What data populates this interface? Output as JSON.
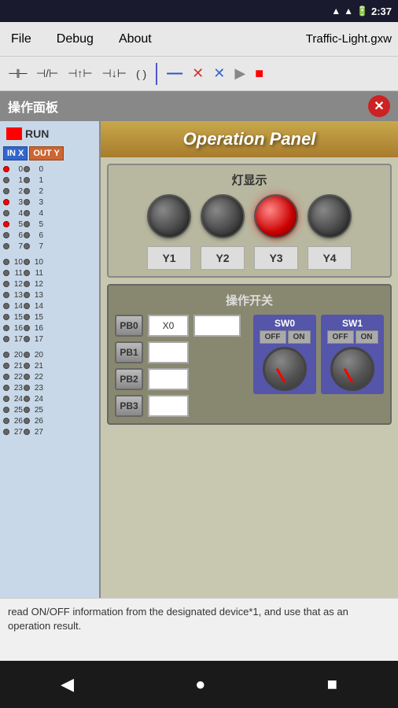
{
  "statusBar": {
    "time": "2:37",
    "icons": [
      "wifi",
      "signal",
      "battery"
    ]
  },
  "menuBar": {
    "items": [
      "File",
      "Debug",
      "About"
    ],
    "title": "Traffic-Light.gxw"
  },
  "toolbar": {
    "buttons": [
      {
        "name": "contact-normally-open",
        "symbol": "⊣⊢"
      },
      {
        "name": "contact-normally-closed",
        "symbol": "⊣/⊢"
      },
      {
        "name": "contact-positive",
        "symbol": "⊣↑⊢"
      },
      {
        "name": "contact-negative",
        "symbol": "⊣↓⊢"
      },
      {
        "name": "coil",
        "symbol": "( )"
      },
      {
        "name": "divider"
      },
      {
        "name": "line",
        "symbol": "—"
      },
      {
        "name": "cross-red",
        "symbol": "✕"
      },
      {
        "name": "cross-blue",
        "symbol": "✕"
      },
      {
        "name": "play",
        "symbol": "▶"
      },
      {
        "name": "stop",
        "symbol": "■"
      }
    ]
  },
  "panelWindow": {
    "title": "操作面板",
    "closeBtn": "✕",
    "runLabel": "RUN",
    "opHeader": "Operation Panel",
    "lightSection": {
      "title": "灯显示",
      "lights": [
        {
          "id": "L1",
          "on": false,
          "label": "Y1"
        },
        {
          "id": "L2",
          "on": false,
          "label": "Y2"
        },
        {
          "id": "L3",
          "on": true,
          "label": "Y3"
        },
        {
          "id": "L4",
          "on": false,
          "label": "Y4"
        }
      ]
    },
    "switchSection": {
      "title": "操作开关",
      "pushButtons": [
        "PB0",
        "PB1",
        "PB2",
        "PB3"
      ],
      "inputs": [
        "X0",
        "",
        "",
        ""
      ],
      "switches": [
        {
          "label": "SW0",
          "offLabel": "OFF",
          "onLabel": "ON"
        },
        {
          "label": "SW1",
          "offLabel": "OFF",
          "onLabel": "ON"
        }
      ]
    },
    "ioSidebar": {
      "inHeader": "IN X",
      "outHeader": "OUT Y",
      "rows": [
        {
          "num": 0,
          "inDot": true,
          "outDot": false
        },
        {
          "num": 1,
          "inDot": false,
          "outDot": false
        },
        {
          "num": 2,
          "inDot": false,
          "outDot": false
        },
        {
          "num": 3,
          "inDot": true,
          "outDot": false
        },
        {
          "num": 4,
          "inDot": false,
          "outDot": false
        },
        {
          "num": 5,
          "inDot": true,
          "outDot": false
        },
        {
          "num": 6,
          "inDot": false,
          "outDot": false
        },
        {
          "num": 7,
          "inDot": false,
          "outDot": false
        },
        {
          "num": 10,
          "inDot": false,
          "outDot": false
        },
        {
          "num": 11,
          "inDot": false,
          "outDot": false
        },
        {
          "num": 12,
          "inDot": false,
          "outDot": false
        },
        {
          "num": 13,
          "inDot": false,
          "outDot": false
        },
        {
          "num": 14,
          "inDot": false,
          "outDot": false
        },
        {
          "num": 15,
          "inDot": false,
          "outDot": false
        },
        {
          "num": 16,
          "inDot": false,
          "outDot": false
        },
        {
          "num": 17,
          "inDot": false,
          "outDot": false
        },
        {
          "num": 20,
          "inDot": false,
          "outDot": false
        },
        {
          "num": 21,
          "inDot": false,
          "outDot": false
        },
        {
          "num": 22,
          "inDot": false,
          "outDot": false
        },
        {
          "num": 23,
          "inDot": false,
          "outDot": false
        },
        {
          "num": 24,
          "inDot": false,
          "outDot": false
        },
        {
          "num": 25,
          "inDot": false,
          "outDot": false
        },
        {
          "num": 26,
          "inDot": false,
          "outDot": false
        },
        {
          "num": 27,
          "inDot": false,
          "outDot": false
        }
      ]
    }
  },
  "bottomText": "read ON/OFF information from the designated device*1, and use that as an operation result.",
  "navBar": {
    "back": "◀",
    "home": "●",
    "recent": "■"
  }
}
